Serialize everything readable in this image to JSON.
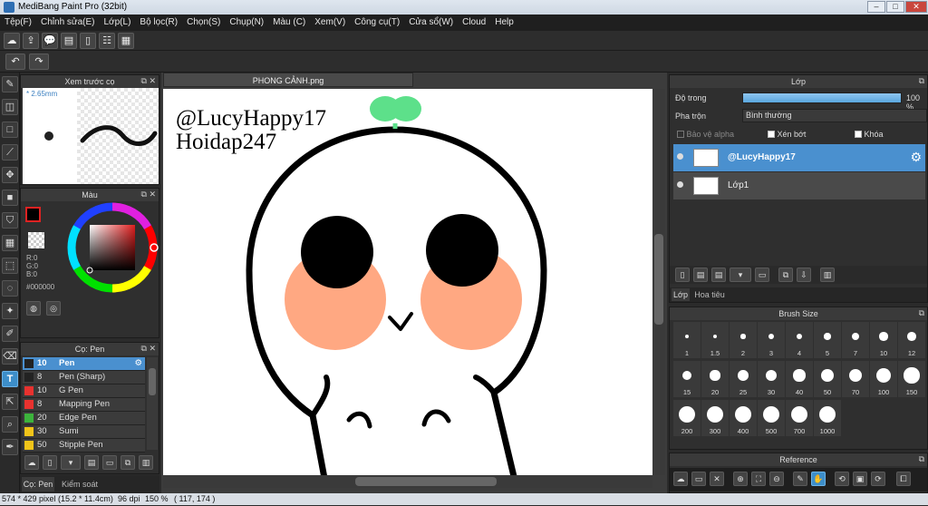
{
  "window": {
    "title": "MediBang Paint Pro (32bit)",
    "minimize": "–",
    "maximize": "□",
    "close": "✕"
  },
  "menu": [
    "Tệp(F)",
    "Chỉnh sửa(E)",
    "Lớp(L)",
    "Bộ lọc(R)",
    "Chọn(S)",
    "Chụp(N)",
    "Màu (C)",
    "Xem(V)",
    "Công cụ(T)",
    "Cửa sổ(W)",
    "Cloud",
    "Help"
  ],
  "toolbar": {
    "icons": [
      "cloud-icon",
      "export-icon",
      "chat-icon",
      "comment-icon",
      "document-icon",
      "grid-list-icon",
      "mosaic-icon"
    ],
    "undo_icon": "↶",
    "redo_icon": "↷"
  },
  "tools": [
    "brush-icon",
    "eraser-icon",
    "rectangle-icon",
    "line-icon",
    "move-icon",
    "fill-rect-icon",
    "bucket-icon",
    "gradient-icon",
    "select-rect-icon",
    "lasso-icon",
    "magic-wand-icon",
    "select-pen-icon",
    "select-eraser-icon",
    "text-icon",
    "operation-icon",
    "eyedropper-icon",
    "pen-icon"
  ],
  "preview_panel": {
    "title": "Xem trước cọ",
    "size": "* 2.65mm"
  },
  "color_panel": {
    "title": "Màu",
    "r": "R:0",
    "g": "G:0",
    "b": "B:0",
    "hex": "#000000",
    "primary": "#000000"
  },
  "brush_panel": {
    "title": "Cọ: Pen",
    "items": [
      {
        "size": "10",
        "name": "Pen",
        "color": "#222222"
      },
      {
        "size": "8",
        "name": "Pen (Sharp)",
        "color": "#222222"
      },
      {
        "size": "10",
        "name": "G Pen",
        "color": "#e8322f"
      },
      {
        "size": "8",
        "name": "Mapping Pen",
        "color": "#e8322f"
      },
      {
        "size": "20",
        "name": "Edge Pen",
        "color": "#3cb33c"
      },
      {
        "size": "30",
        "name": "Sumi",
        "color": "#f0c419"
      },
      {
        "size": "50",
        "name": "Stipple Pen",
        "color": "#f0c419"
      }
    ]
  },
  "left_tabs": [
    "Cọ: Pen",
    "Kiểm soát cọ"
  ],
  "document": {
    "tab": "PHONG CẢNH.png",
    "text_line1": "@LucyHappy17",
    "text_line2": "Hoidap247"
  },
  "layer_panel": {
    "title": "Lớp",
    "opacity_label": "Độ trong",
    "opacity_value": "100 %",
    "opacity_fraction": 1.0,
    "blend_label": "Pha trộn",
    "blend_value": "Bình thường",
    "protect_alpha": "Bảo vệ alpha",
    "clipping": "Xén bớt",
    "lock": "Khóa",
    "layers": [
      {
        "name": "@LucyHappy17",
        "selected": true
      },
      {
        "name": "Lớp1",
        "selected": false
      }
    ],
    "tabs": [
      "Lớp",
      "Hoa tiêu"
    ]
  },
  "brush_size_panel": {
    "title": "Brush Size",
    "sizes": [
      "1",
      "1.5",
      "2",
      "3",
      "4",
      "5",
      "7",
      "10",
      "12",
      "15",
      "20",
      "25",
      "30",
      "40",
      "50",
      "70",
      "100",
      "150",
      "200",
      "300",
      "400",
      "500",
      "700",
      "1000"
    ]
  },
  "reference_panel": {
    "title": "Reference"
  },
  "status": {
    "size": "574 * 429 pixel",
    "physical": "(15.2 * 11.4cm)",
    "dpi": "96 dpi",
    "zoom": "150 %",
    "coords": "( 117, 174 )"
  },
  "colors": {
    "accent": "#4a90cf",
    "blush": "#ffa882",
    "sprout": "#5de08a"
  }
}
